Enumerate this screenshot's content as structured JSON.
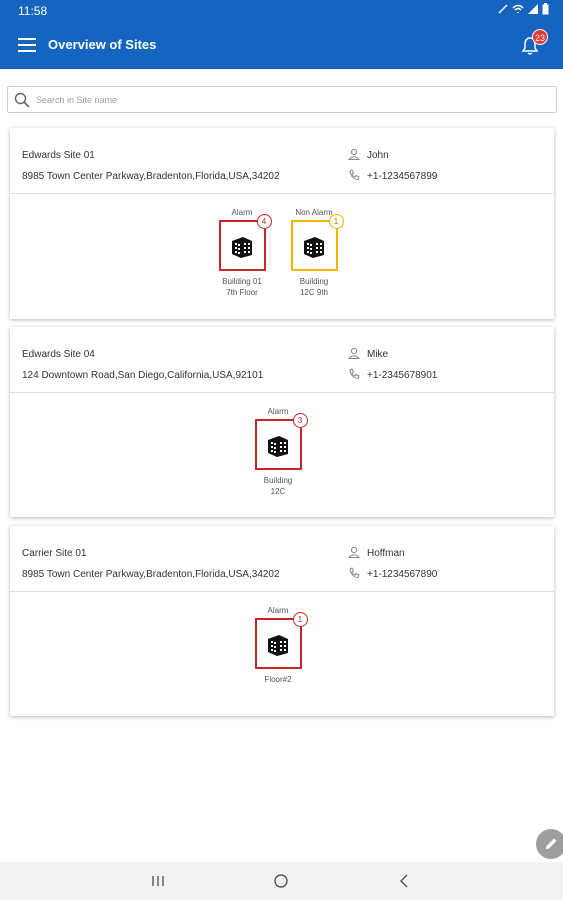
{
  "status_bar": {
    "time": "11:58"
  },
  "app_bar": {
    "title": "Overview of Sites",
    "notification_count": "23"
  },
  "search": {
    "placeholder": "Search in Site name",
    "value": ""
  },
  "sites": [
    {
      "name": "Edwards Site 01",
      "address": "8985 Town Center Parkway,Bradenton,Florida,USA,34202",
      "contact": "John",
      "phone": "+1-1234567899",
      "buildings": [
        {
          "status": "Alarm",
          "count": "4",
          "name_line1": "Building 01",
          "name_line2": "7th Floor"
        },
        {
          "status": "Non Alarm",
          "count": "1",
          "name_line1": "Building",
          "name_line2": "12C 9th"
        }
      ]
    },
    {
      "name": "Edwards Site 04",
      "address": "124 Downtown Road,San Diego,California,USA,92101",
      "contact": "Mike",
      "phone": "+1-2345678901",
      "buildings": [
        {
          "status": "Alarm",
          "count": "3",
          "name_line1": "Building",
          "name_line2": "12C"
        }
      ]
    },
    {
      "name": "Carrier Site 01",
      "address": "8985 Town Center Parkway,Bradenton,Florida,USA,34202",
      "contact": "Hoffman",
      "phone": "+1-1234567890",
      "buildings": [
        {
          "status": "Alarm",
          "count": "1",
          "name_line1": "Floor#2",
          "name_line2": ""
        }
      ]
    }
  ],
  "colors": {
    "primary": "#1565c0",
    "alarm": "#c62828",
    "non_alarm": "#f5b400",
    "badge": "#e53935"
  }
}
